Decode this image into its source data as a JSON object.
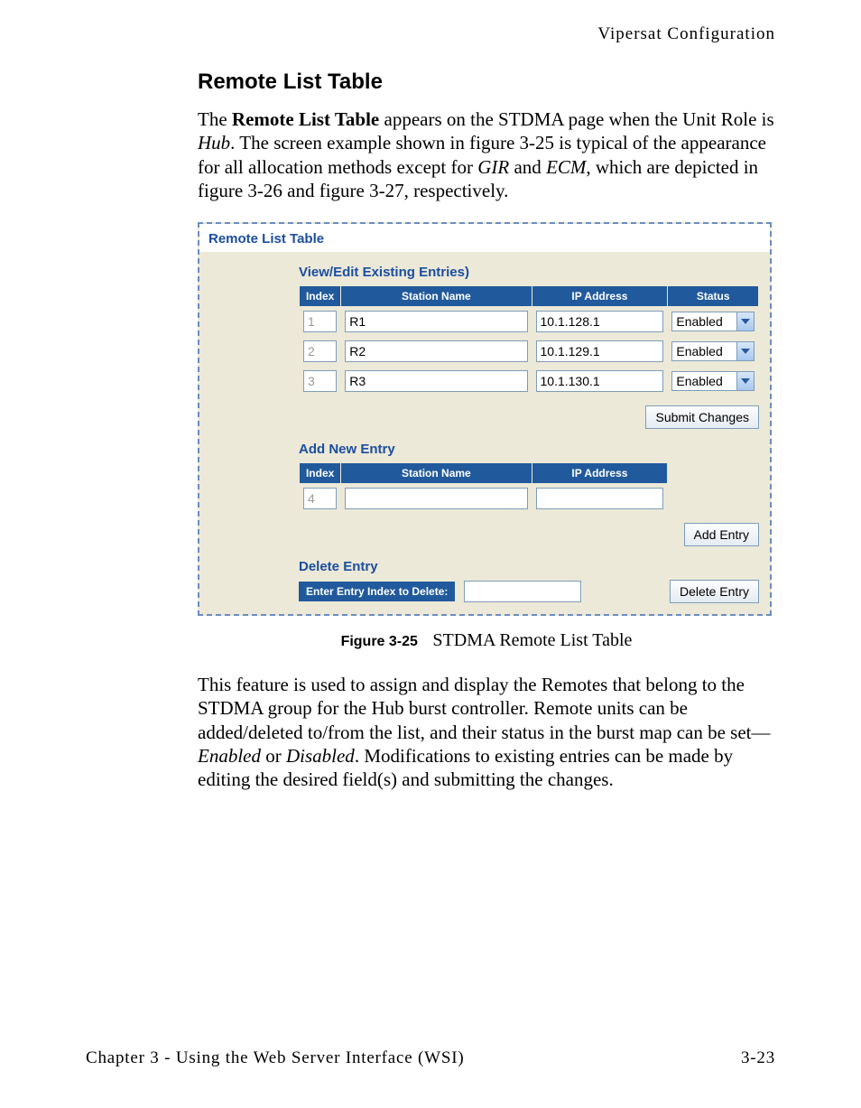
{
  "header": {
    "right": "Vipersat Configuration"
  },
  "section": {
    "title": "Remote List Table"
  },
  "intro": {
    "p1a": "The ",
    "bold1": "Remote List Table",
    "p1b": " appears on the STDMA page when the Unit Role is ",
    "italic_hub": "Hub",
    "p1c": ". The screen example shown in figure 3-25 is typical of the appearance for all allocation methods except for ",
    "italic_gir": "GIR",
    "and": " and ",
    "italic_ecm": "ECM",
    "p1d": ", which are depicted in figure 3-26 and figure 3-27, respectively."
  },
  "panel": {
    "title": "Remote List Table",
    "columns": {
      "index": "Index",
      "station": "Station Name",
      "ip": "IP Address",
      "status": "Status"
    },
    "view_edit": {
      "heading": "View/Edit Existing Entries)",
      "rows": [
        {
          "index": "1",
          "station": "R1",
          "ip": "10.1.128.1",
          "status": "Enabled"
        },
        {
          "index": "2",
          "station": "R2",
          "ip": "10.1.129.1",
          "status": "Enabled"
        },
        {
          "index": "3",
          "station": "R3",
          "ip": "10.1.130.1",
          "status": "Enabled"
        }
      ],
      "submit_label": "Submit Changes"
    },
    "add": {
      "heading": "Add New Entry",
      "row": {
        "index": "4",
        "station": "",
        "ip": ""
      },
      "button_label": "Add Entry"
    },
    "del": {
      "heading": "Delete Entry",
      "label": "Enter Entry Index to Delete:",
      "value": "",
      "button_label": "Delete Entry"
    }
  },
  "figure": {
    "number": "Figure 3-25",
    "title": "STDMA Remote List Table"
  },
  "body": {
    "p1a": "This feature is used to assign and display the Remotes that belong to the STDMA group for the Hub burst controller. Remote units can be added/deleted to/from the list, and their status in the burst map can be set—",
    "italic_enabled": "Enabled",
    "or": " or ",
    "italic_disabled": "Disabled",
    "p1b": ". Modifications to existing entries can be made by editing the desired field(s) and submitting the changes."
  },
  "footer": {
    "left": "Chapter 3 - Using the Web Server Interface (WSI)",
    "right": "3-23"
  }
}
